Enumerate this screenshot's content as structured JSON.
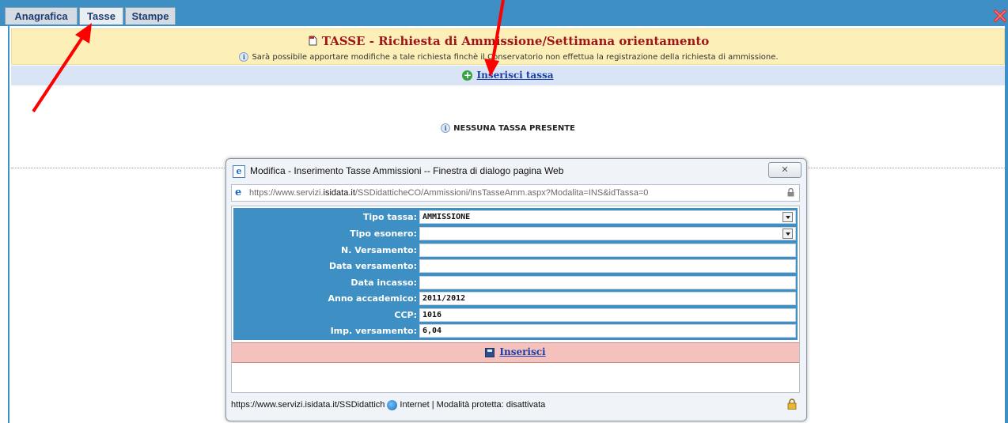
{
  "tabs": [
    {
      "label": "Anagrafica",
      "active": false
    },
    {
      "label": "Tasse",
      "active": true
    },
    {
      "label": "Stampe",
      "active": false
    }
  ],
  "header": {
    "title": "TASSE - Richiesta di Ammissione/Settimana orientamento",
    "note": "Sarà possibile apportare modifiche a tale richiesta finchè il Conservatorio non effettua la registrazione della richiesta di ammissione."
  },
  "actions": {
    "insert_tax_label": "Inserisci tassa"
  },
  "empty_message": "NESSUNA TASSA PRESENTE",
  "dialog": {
    "title": "Modifica - Inserimento Tasse Ammissioni -- Finestra di dialogo pagina Web",
    "url_prefix": "https://www.servizi.",
    "url_domain": "isidata.it",
    "url_path": "/SSDidatticheCO/Ammissioni/InsTasseAmm.aspx?Modalita=INS&idTassa=0",
    "fields": [
      {
        "label": "Tipo tassa:",
        "value": "AMMISSIONE",
        "type": "select"
      },
      {
        "label": "Tipo esonero:",
        "value": "",
        "type": "select"
      },
      {
        "label": "N. Versamento:",
        "value": "",
        "type": "text"
      },
      {
        "label": "Data versamento:",
        "value": "",
        "type": "text"
      },
      {
        "label": "Data incasso:",
        "value": "",
        "type": "text"
      },
      {
        "label": "Anno accademico:",
        "value": "2011/2012",
        "type": "text"
      },
      {
        "label": "CCP:",
        "value": "1016",
        "type": "text"
      },
      {
        "label": "Imp. versamento:",
        "value": "6,04",
        "type": "text"
      }
    ],
    "submit_label": "Inserisci",
    "status_url": "https://www.servizi.isidata.it/SSDidattich",
    "status_zone": "Internet | Modalità protetta: disattivata"
  },
  "colors": {
    "brand_blue": "#3e8fc4",
    "header_bg": "#fcefb8",
    "title_red": "#a0151a",
    "link_blue": "#1a3faa",
    "submit_band": "#f4c1bc",
    "annotation_arrow": "#ff0000"
  },
  "icons": [
    "close-x-icon",
    "document-icon",
    "info-icon",
    "add-circle-icon",
    "ie-icon",
    "lock-icon",
    "select-arrow-icon",
    "floppy-save-icon",
    "globe-icon",
    "padlock-icon"
  ]
}
